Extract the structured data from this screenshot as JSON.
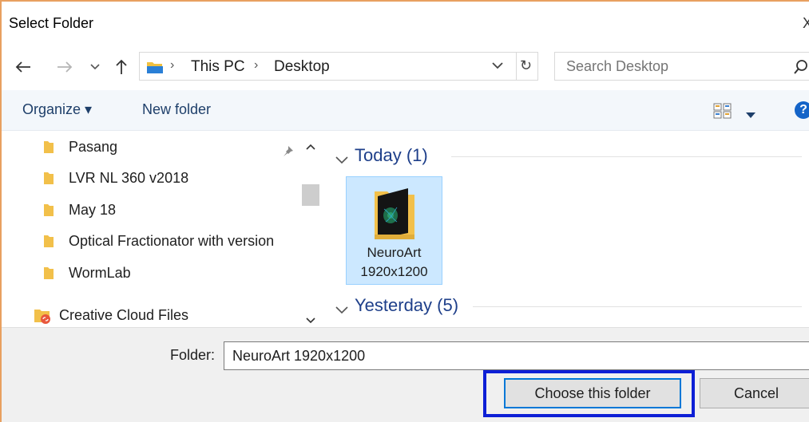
{
  "window": {
    "title": "Select Folder",
    "close_glyph": "X"
  },
  "address": {
    "crumbs": [
      "This PC",
      "Desktop"
    ],
    "search_placeholder": "Search Desktop"
  },
  "toolbar": {
    "organize_label": "Organize ▾",
    "new_folder_label": "New folder"
  },
  "nav_pane": {
    "items": [
      {
        "label": "Pasang",
        "icon": "folder-icon"
      },
      {
        "label": "LVR NL 360 v2018",
        "icon": "folder-icon"
      },
      {
        "label": "May 18",
        "icon": "folder-icon"
      },
      {
        "label": "Optical Fractionator with version",
        "icon": "folder-icon"
      },
      {
        "label": "WormLab",
        "icon": "folder-icon"
      }
    ],
    "creative_cloud_label": "Creative Cloud Files"
  },
  "content": {
    "groups": [
      {
        "label": "Today (1)"
      },
      {
        "label": "Yesterday (5)"
      }
    ],
    "selected_item": {
      "name_line1": "NeuroArt",
      "name_line2": "1920x1200"
    }
  },
  "footer": {
    "folder_label": "Folder:",
    "folder_value": "NeuroArt 1920x1200",
    "choose_label": "Choose this folder",
    "cancel_label": "Cancel"
  },
  "colors": {
    "window_border": "#e8a060",
    "selection_fill": "#cce8ff",
    "highlight_box": "#0d1fd6",
    "accent": "#0078d7"
  }
}
